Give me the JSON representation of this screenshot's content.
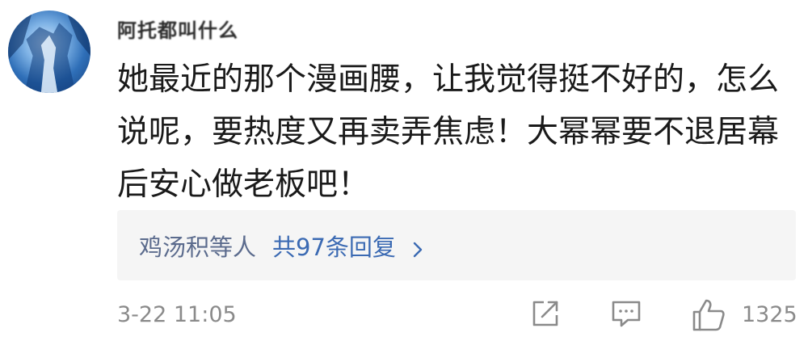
{
  "comment": {
    "username": "阿托都叫什么",
    "text": "她最近的那个漫画腰，让我觉得挺不好的，怎么说呢，要热度又再卖弄焦虑！大幂幂要不退居幕后安心做老板吧！",
    "replies": {
      "names": "鸡汤积等人",
      "count_label": "共97条回复"
    },
    "timestamp": "3-22 11:05",
    "like_count": "1325"
  },
  "icons": {
    "share": "share-icon",
    "comment": "comment-icon",
    "like": "thumbs-up-icon",
    "chevron": "chevron-right-icon"
  },
  "colors": {
    "reply_names": "#5b6b8d",
    "reply_count": "#3b6ab3",
    "meta_gray": "#8a8a8a",
    "reply_bg": "#f5f5f5"
  }
}
